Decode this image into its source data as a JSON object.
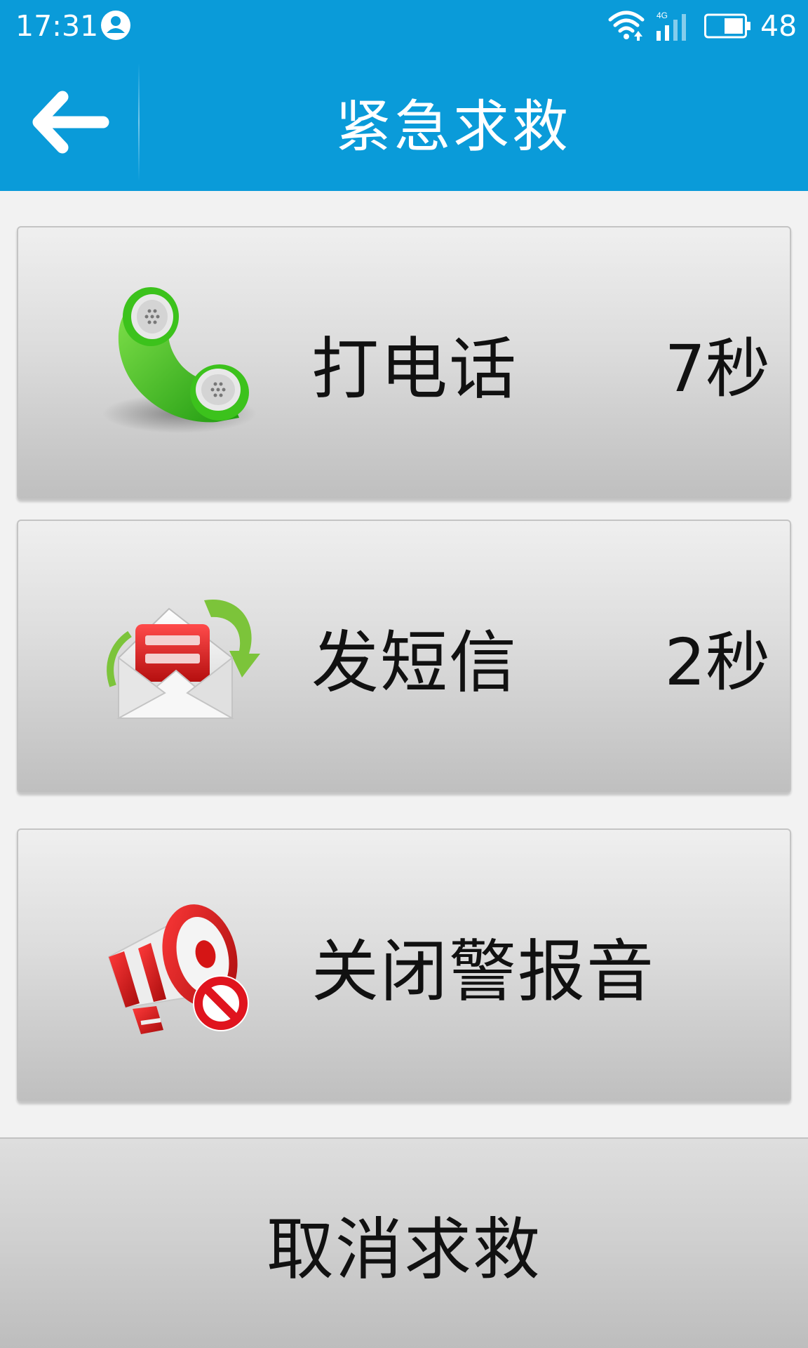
{
  "status_bar": {
    "time": "17:31",
    "battery": "48",
    "icons": [
      "user-icon",
      "wifi-icon",
      "4g-signal-icon",
      "battery-icon"
    ]
  },
  "title_bar": {
    "back_icon": "back-arrow-icon",
    "title": "紧急求救"
  },
  "actions": [
    {
      "label": "打电话",
      "timer": "7秒",
      "icon": "phone-icon"
    },
    {
      "label": "发短信",
      "timer": "2秒",
      "icon": "envelope-icon"
    },
    {
      "label": "关闭警报音",
      "icon": "megaphone-mute-icon"
    }
  ],
  "cancel": {
    "label": "取消求救"
  },
  "colors": {
    "primary": "#0a9bd9",
    "phone_green": "#3cc21c",
    "alert_red": "#e0141e",
    "background": "#f2f2f2"
  }
}
